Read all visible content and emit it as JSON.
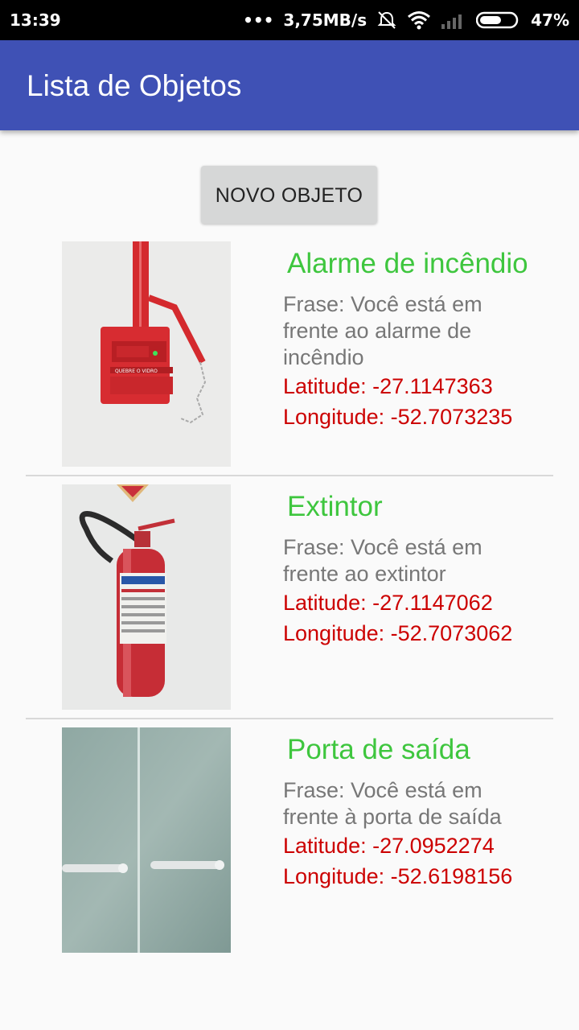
{
  "status_bar": {
    "time": "13:39",
    "network_speed": "3,75MB/s",
    "battery_percent": "47%",
    "icons": [
      "more-dots-icon",
      "mute-icon",
      "wifi-icon",
      "signal-icon",
      "battery-icon"
    ]
  },
  "app_bar": {
    "title": "Lista de Objetos",
    "color": "#3f51b5"
  },
  "new_object_button": {
    "label": "NOVO OBJETO"
  },
  "items": [
    {
      "name": "Alarme de incêndio",
      "phrase": "Frase: Você está em frente ao alarme de incêndio",
      "latitude": "Latitude: -27.1147363",
      "longitude": "Longitude: -52.7073235",
      "image": "fire-alarm-photo"
    },
    {
      "name": "Extintor",
      "phrase": "Frase: Você está em frente ao extintor",
      "latitude": "Latitude: -27.1147062",
      "longitude": "Longitude: -52.7073062",
      "image": "fire-extinguisher-photo"
    },
    {
      "name": "Porta de saída",
      "phrase": "Frase: Você está em frente à porta de saída",
      "latitude": "Latitude: -27.0952274",
      "longitude": "Longitude: -52.6198156",
      "image": "exit-door-photo"
    }
  ],
  "colors": {
    "name": "#3ec63e",
    "coords": "#cc0000",
    "phrase": "#777777"
  }
}
